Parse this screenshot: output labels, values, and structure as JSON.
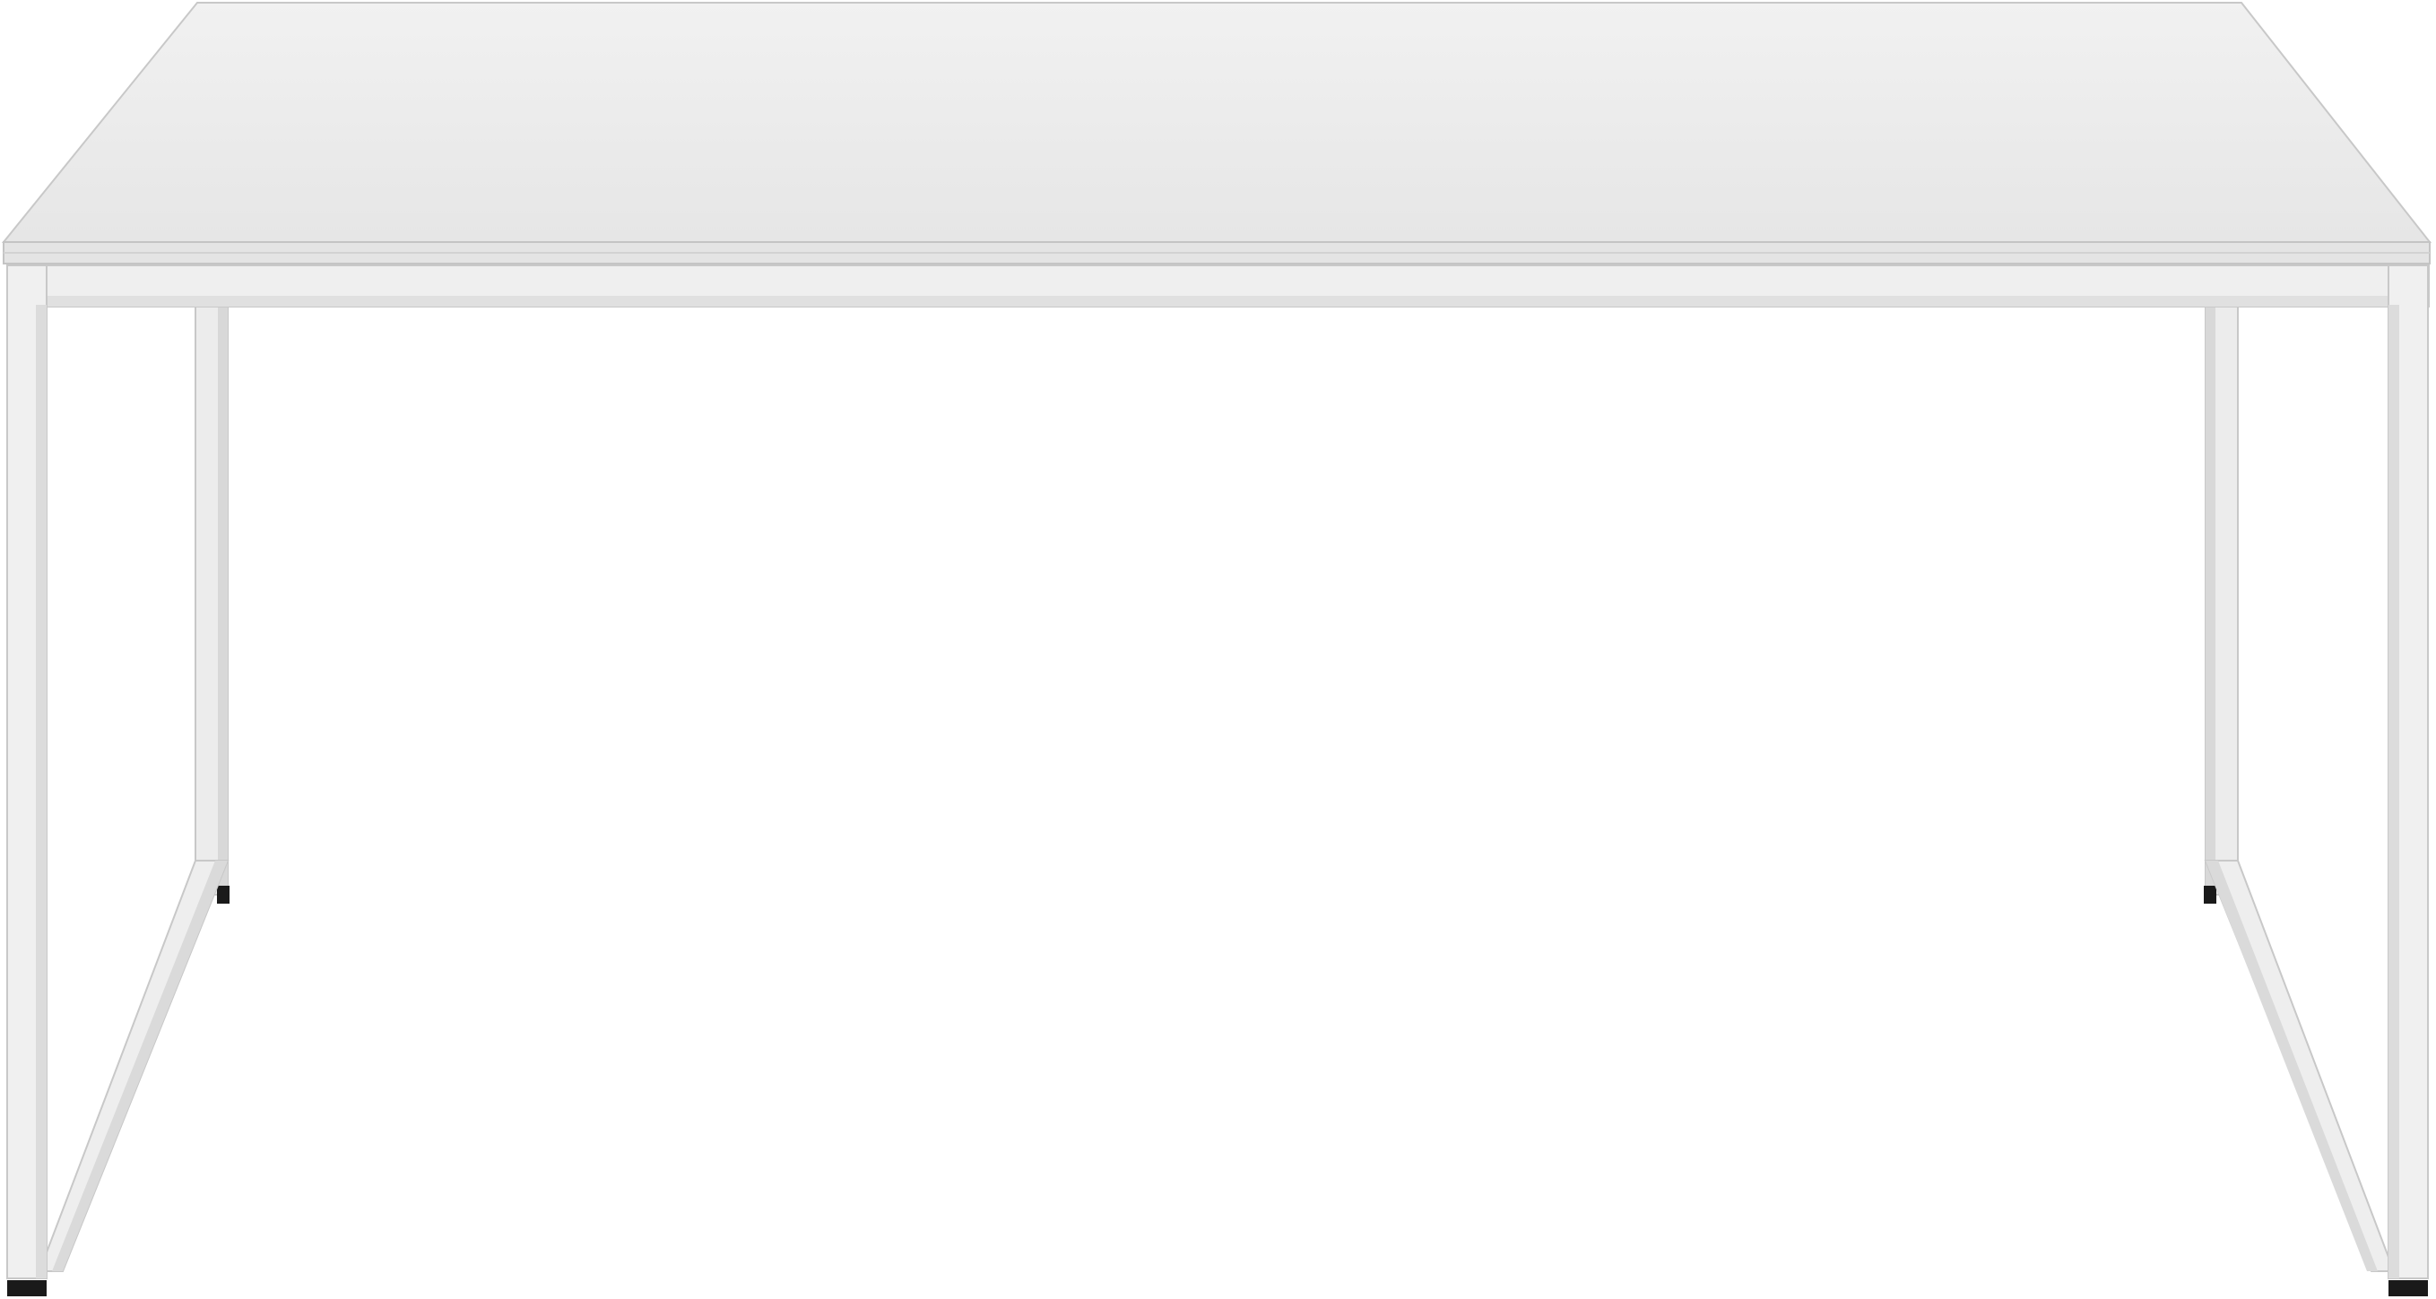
{
  "image": {
    "subject": "table",
    "colors": {
      "background": "#ffffff",
      "tabletop": "#ececec",
      "tabletop_edge": "#dcdcdc",
      "frame": "#eeeeee",
      "frame_shadow": "#d6d6d6",
      "outline": "#c8c8c8",
      "feet": "#1a1a1a"
    }
  }
}
